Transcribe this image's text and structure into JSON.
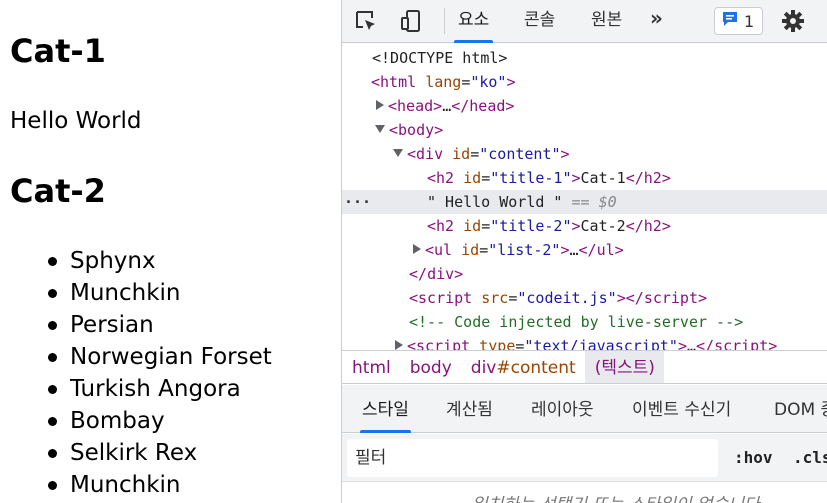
{
  "page": {
    "heading1": "Cat-1",
    "paragraph": "Hello World",
    "heading2": "Cat-2",
    "list": [
      "Sphynx",
      "Munchkin",
      "Persian",
      "Norwegian Forset",
      "Turkish Angora",
      "Bombay",
      "Selkirk Rex",
      "Munchkin"
    ]
  },
  "devtools": {
    "tabs": [
      "요소",
      "콘솔",
      "원본"
    ],
    "active_tab": "요소",
    "more_label": "»",
    "issues_count": "1",
    "tree": {
      "doctype": "<!DOCTYPE html>",
      "html_tag": "html",
      "html_attr": "lang",
      "html_val": "\"ko\"",
      "head": "head",
      "body": "body",
      "div": "div",
      "div_attr": "id",
      "div_val": "\"content\"",
      "h2": "h2",
      "h2_attr": "id",
      "h2a_val": "\"title-1\"",
      "h2a_text": "Cat-1",
      "selected_text": "\" Hello World \"",
      "selected_marker": "== $0",
      "h2b_val": "\"title-2\"",
      "h2b_text": "Cat-2",
      "ul": "ul",
      "ul_attr": "id",
      "ul_val": "\"list-2\"",
      "ellipsis": "…",
      "script": "script",
      "script_attr": "src",
      "script_val": "\"codeit.js\"",
      "comment": "<!-- Code injected by live-server -->",
      "script2_attr": "type",
      "script2_val": "\"text/javascript\""
    },
    "breadcrumbs": {
      "html": "html",
      "body": "body",
      "div_tag": "div",
      "div_id": "#content",
      "text": "(텍스트)"
    },
    "style_tabs": [
      "스타일",
      "계산됨",
      "레이아웃",
      "이벤트 수신기",
      "DOM 중"
    ],
    "filter_placeholder": "필터",
    "hov": ":hov",
    "cls": ".cls",
    "empty_message": "일치하는 선택기 또는 스타일이 없습니다"
  },
  "colors": {
    "accent": "#1a73e8",
    "tag": "#881280",
    "attr_name": "#994500",
    "attr_value": "#1a1aa6",
    "comment": "#236e25"
  }
}
